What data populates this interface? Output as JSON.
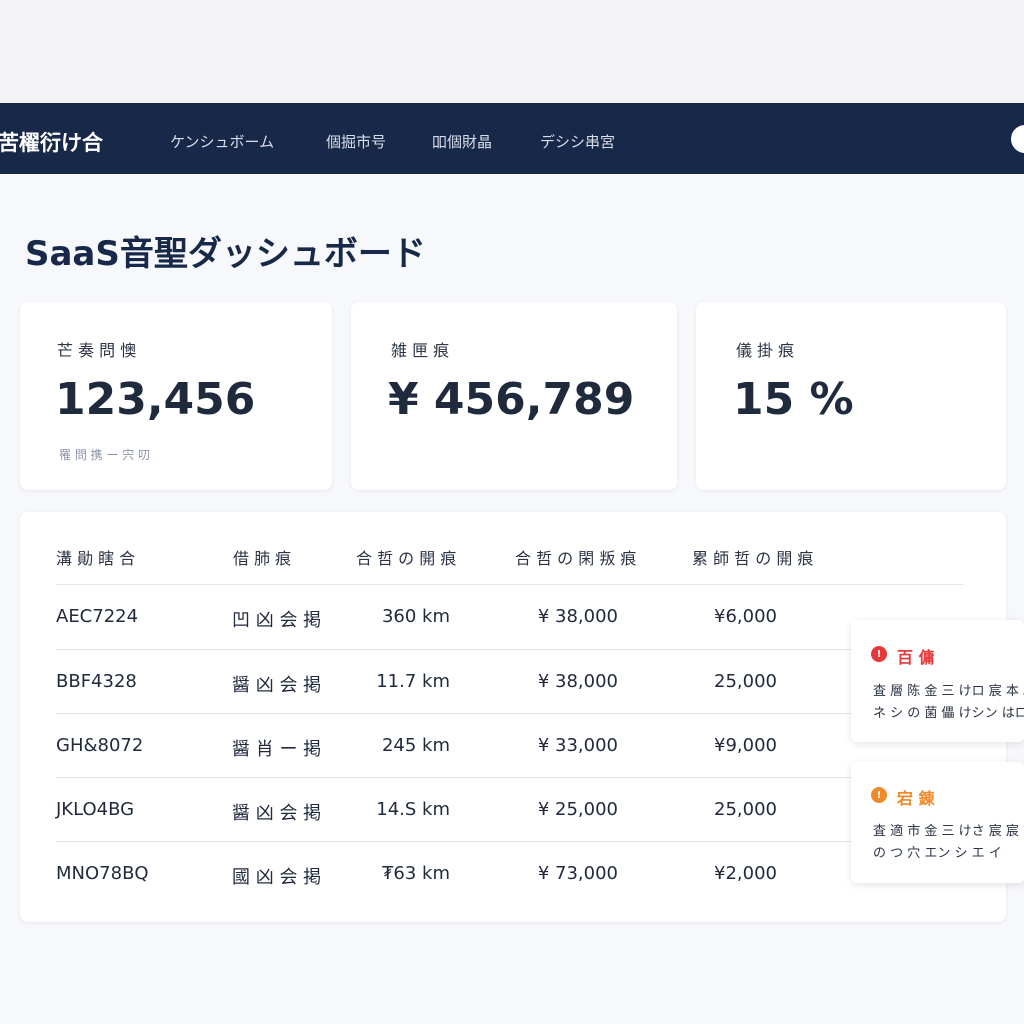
{
  "nav": {
    "brand": "苦櫂衍け合",
    "links": [
      "ケンシュボーム",
      "個掘市号",
      "吅個財晶",
      "デシシ串宮"
    ],
    "avatar_icon": "user-avatar-icon"
  },
  "page": {
    "title": "SaaS音聖ダッシュボード"
  },
  "kpis": [
    {
      "label": "芒 奏 問 懊",
      "value": "123,456",
      "sub": "罹 問 携 ー 宍 叨"
    },
    {
      "label": "雑 匣 痕",
      "value": "¥ 456,789"
    },
    {
      "label": "儀 掛 痕",
      "value": "15 %"
    }
  ],
  "table": {
    "headers": [
      "溝 勛 瞎 合",
      "借 肺 痕",
      "合 哲 の 開 痕",
      "合 哲 の 閑 叛 痕",
      "累 師 哲 の 開 痕"
    ],
    "rows": [
      [
        "AEC7224",
        "凹 凶  会 掲",
        "360 km",
        "¥ 38,000",
        "¥6,000"
      ],
      [
        "BBF4328",
        "醤 凶  会 掲",
        "11.7 km",
        "¥ 38,000",
        "25,000"
      ],
      [
        "GH&8072",
        "醤 肖 ー 掲",
        "245 km",
        "¥ 33,000",
        "¥9,000"
      ],
      [
        "JKLO4BG",
        "醤 凶  会 掲",
        "14.S km",
        "¥ 25,000",
        "25,000"
      ],
      [
        "MNO78BQ",
        "國 凶  会 掲",
        "₮63 km",
        "¥ 73,000",
        "¥2,000"
      ]
    ]
  },
  "alerts": [
    {
      "title": "百 傭",
      "color": "#e5383b",
      "icon": "alert-icon",
      "line1": "査 層 陈 金 三 けロ 宸 本 。",
      "line2": "ネ シ の 菌 儡 けシン はロ 孟 ・"
    },
    {
      "title": "宕 錬",
      "color": "#ef8a2b",
      "icon": "warning-icon",
      "line1": "査 適 市 金 三 けさ 宸 宸 亦 」",
      "line2": "の つ 穴 エン シ エ イ"
    }
  ]
}
